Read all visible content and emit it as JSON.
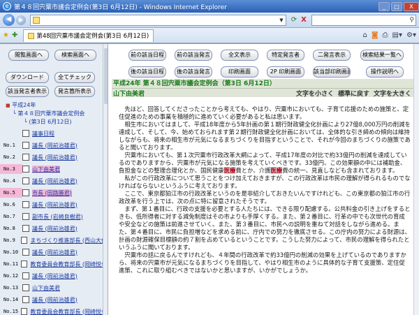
{
  "window": {
    "title": "第４８回宍粟市議会定例会(第3日 6月12日) - Windows Internet Explorer",
    "min_label": "_",
    "max_label": "□",
    "close_label": "X"
  },
  "addressbar": {
    "back_label": "◀",
    "forward_label": "▶",
    "refresh_label": "⟳",
    "stop_label": "X",
    "url": ""
  },
  "tab": {
    "title": "第48回宍粟市議会定例会(第3日 6月12日)"
  },
  "left": {
    "buttons": {
      "search_screen": "閲覧画面へ",
      "search_screen2": "検索画面へ",
      "download": "ダウンロード",
      "check_all": "全てチェック",
      "speaker_list": "該当発言者表示",
      "speech_list": "発言箇所表示"
    },
    "tree": {
      "year": "平成24年",
      "session": "第４８回宍粟市議会定例会",
      "day": "(第3日 6月12日)"
    },
    "rows": [
      {
        "num": "",
        "label": "議事日程",
        "highlight": false
      },
      {
        "num": "No.1",
        "label": "議長 (岡前治雄君)",
        "highlight": false
      },
      {
        "num": "No.2",
        "label": "議長 (岡前治雄君)",
        "highlight": false
      },
      {
        "num": "No.3",
        "label": "山下由美君",
        "highlight": true
      },
      {
        "num": "No.4",
        "label": "議長 (岡前治雄君)",
        "highlight": false
      },
      {
        "num": "No.5",
        "label": "市長 (田路勝君)",
        "highlight": true
      },
      {
        "num": "No.6",
        "label": "議長 (岡前治雄君)",
        "highlight": false
      },
      {
        "num": "No.7",
        "label": "副市長 (岩崎良樹君)",
        "highlight": false
      },
      {
        "num": "No.8",
        "label": "議長 (岡前治雄君)",
        "highlight": false
      },
      {
        "num": "No.9",
        "label": "まちづくり推進部長 (西山大作君)",
        "highlight": false
      },
      {
        "num": "No.10",
        "label": "議長 (岡前治雄君)",
        "highlight": false
      },
      {
        "num": "No.11",
        "label": "教育委員会教育部長 (岡崎悦也君)",
        "highlight": false
      },
      {
        "num": "No.12",
        "label": "議長 (岡前治雄君)",
        "highlight": false
      },
      {
        "num": "No.13",
        "label": "山下由美君",
        "highlight": false
      },
      {
        "num": "No.14",
        "label": "議長 (岡前治雄君)",
        "highlight": false
      },
      {
        "num": "No.15",
        "label": "教育委員会教育部長 (岡崎悦也君)",
        "highlight": false
      }
    ]
  },
  "toolbar": {
    "prev_day": "前の該当日程",
    "prev_speech": "前の該当発言",
    "full_display": "全文表示",
    "specific_speech": "特定発言者",
    "two_screen": "二発言表示",
    "search_results": "検索結果一覧へ",
    "next_day": "後の該当日程",
    "next_speech": "後の該当発言",
    "print_screen": "印刷画面",
    "print_2p": "2P 印刷画面",
    "print_hit": "該当部印刷画面",
    "help": "操作説明へ"
  },
  "main": {
    "title": "平成24年 第４８回宍粟市議会定例会（第3日 6月12日）",
    "speaker": "山下由美君",
    "font_small": "文字を小さく",
    "font_normal": "標準に戻す",
    "font_large": "文字を大きく",
    "paragraphs": [
      "先ほど、回答してくださったことから考えても、やはり、宍粟市においても、子育て応援のための施策と、定住促進のための事業を積極的に進めていく必要があると私は思います。",
      "相生市においてはまして、平成18年度から5年計画の第１期行財政健全化計画により27億8,000万円の削減を達成して、そして、今、始めておられます第２期行財政健全化計画においては、全体的な引き締めの傾向は維持しながらも、将来の相生市が元気になるまちづくりを目指すということで、それが今回のまちづくりの施策であると聞いております。",
      "宍粟市においても、第１次宍粟市行政改革大綱によって、平成17年度の対比で約33億円の削減を達成しているのでありますから、宍粟市が元気になる施策を考えていくべきです。33億円、この効果額の中には補助金、負担金などの整理合理化とか、国民健康",
      "私がこの行政改革について思うことをつけ加えておきますが、この行政改革は市民の理解が得られるものでなければならないというふうに考えております。",
      "ここで、東京都狛江市の行政改革というのを是非紹介しておきたいんですけれども、この東京都の狛江市の行政改革を行う上では、次の点に特に留意されたそうです。",
      "まず、第１番目に、行政の支援を必要とする人たちには、できる限り配慮する。公共料金の引き上げをするときも、低所得者に対する減免制度はその市よりも手厚くする。また、第２番目に、行革の中でも次世代の育成や安全などの施策は前進させていく。また、第３番目に、市民への説明を重ねて対話をしながら進める。また、第４番目に、市民に負担増などを求める前に、庁内での努力を徹底させる。この庁内の努力による財源は、計画の財源確保目標額の約７割を占めているということです。こうした努力によって、市民の理解を得られたというふうに聞いております。",
      "宍粟市の話に戻るんですけれども、４年間の行政改革で約33億円の削減の効果を上げているのでありますから、将来の宍粟市が元気になるまちづくりを目指して、やはり相生市のように具体的な子育て支援策、定住促進策、これに取り組むべきではないかと思いますが、いかがでしょうか。"
    ],
    "p3_hl1": "医療",
    "p3_mid": "費とか、介護",
    "p3_hl2": "医療",
    "p3_tail": "費の統一、見直しなども含まれております。"
  }
}
